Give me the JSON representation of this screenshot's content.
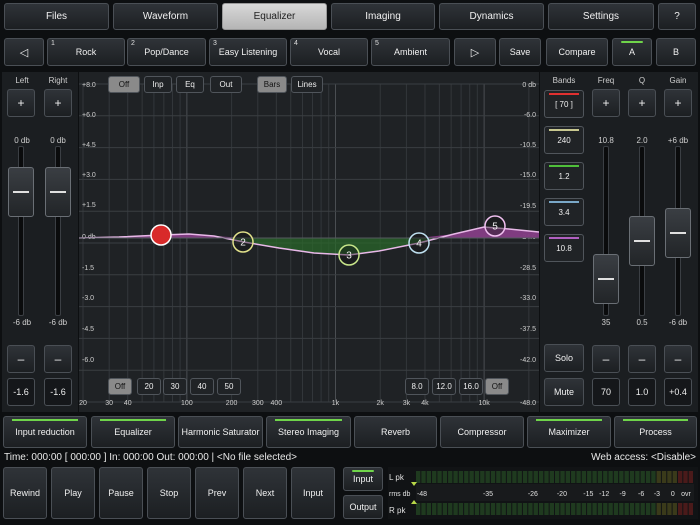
{
  "tabs": [
    {
      "label": "Files"
    },
    {
      "label": "Waveform"
    },
    {
      "label": "Equalizer"
    },
    {
      "label": "Imaging"
    },
    {
      "label": "Dynamics"
    },
    {
      "label": "Settings"
    },
    {
      "label": "?"
    }
  ],
  "presets": {
    "prev_label": "◁",
    "next_label": "▷",
    "items": [
      {
        "num": "1",
        "label": "Rock"
      },
      {
        "num": "2",
        "label": "Pop/Dance"
      },
      {
        "num": "3",
        "label": "Easy Listening"
      },
      {
        "num": "4",
        "label": "Vocal"
      },
      {
        "num": "5",
        "label": "Ambient"
      }
    ],
    "save_label": "Save",
    "compare_label": "Compare",
    "a_label": "A",
    "b_label": "B"
  },
  "left_panel": {
    "left_label": "Left",
    "right_label": "Right",
    "plus": "+",
    "minus": "–",
    "top_db": "0 db",
    "bottom_db": "-6 db",
    "left_value": "-1.6",
    "right_value": "-1.6"
  },
  "graph": {
    "view_buttons": [
      "Off",
      "Inp",
      "Eq",
      "Out"
    ],
    "mode_buttons": [
      "Bars",
      "Lines"
    ],
    "left_scale": [
      "+8.0",
      "+6.0",
      "+4.5",
      "+3.0",
      "+1.5",
      "0 db",
      "-1.5",
      "-3.0",
      "-4.5",
      "-6.0"
    ],
    "right_scale": [
      "0 db",
      "-6.0",
      "-10.5",
      "-15.0",
      "-19.5",
      "-24.0",
      "-28.5",
      "-33.0",
      "-37.5",
      "-42.0",
      "-48.0"
    ],
    "freq_labels": [
      "20",
      "30",
      "40",
      "100",
      "200",
      "300",
      "400",
      "1k",
      "2k",
      "3k",
      "4k",
      "10k"
    ],
    "low_cut": [
      "Off",
      "20",
      "30",
      "40",
      "50"
    ],
    "high_cut": [
      "8.0",
      "12.0",
      "16.0",
      "Off"
    ],
    "nodes": [
      "1",
      "2",
      "3",
      "4",
      "5"
    ]
  },
  "bands": {
    "title": "Bands",
    "items": [
      {
        "label": "[ 70 ]",
        "color": "#e03030"
      },
      {
        "label": "240",
        "color": "#c8c890"
      },
      {
        "label": "1.2",
        "color": "#4fbf3a"
      },
      {
        "label": "3.4",
        "color": "#7aa8c8"
      },
      {
        "label": "10.8",
        "color": "#b060c0"
      }
    ],
    "solo_label": "Solo",
    "mute_label": "Mute"
  },
  "params": {
    "freq": {
      "label": "Freq",
      "top": "10.8",
      "bottom": "35",
      "value": "70"
    },
    "q": {
      "label": "Q",
      "top": "2.0",
      "bottom": "0.5",
      "value": "1.0"
    },
    "gain": {
      "label": "Gain",
      "top": "+6 db",
      "bottom": "-6 db",
      "value": "+0.4"
    },
    "plus": "+",
    "minus": "–"
  },
  "modules": [
    {
      "label": "Input reduction",
      "on": true
    },
    {
      "label": "Equalizer",
      "on": true
    },
    {
      "label": "Harmonic Saturator",
      "on": false
    },
    {
      "label": "Stereo Imaging",
      "on": true
    },
    {
      "label": "Reverb",
      "on": false
    },
    {
      "label": "Compressor",
      "on": false
    },
    {
      "label": "Maximizer",
      "on": true
    },
    {
      "label": "Process",
      "on": true
    }
  ],
  "status": {
    "left": "Time: 000:00  [  000:00  ]  In: 000:00  Out: 000:00   |   <No file selected>",
    "right": "Web access: <Disable>"
  },
  "transport": [
    "Rewind",
    "Play",
    "Pause",
    "Stop",
    "Prev",
    "Next",
    "Input"
  ],
  "meter": {
    "input_label": "Input",
    "output_label": "Output",
    "l_label": "L pk",
    "rms_label": "rms db",
    "r_label": "R pk",
    "scale": [
      "-48",
      "-35",
      "-26",
      "-20",
      "-15",
      "-12",
      "-9",
      "-6",
      "-3",
      "0",
      "ovr"
    ]
  }
}
